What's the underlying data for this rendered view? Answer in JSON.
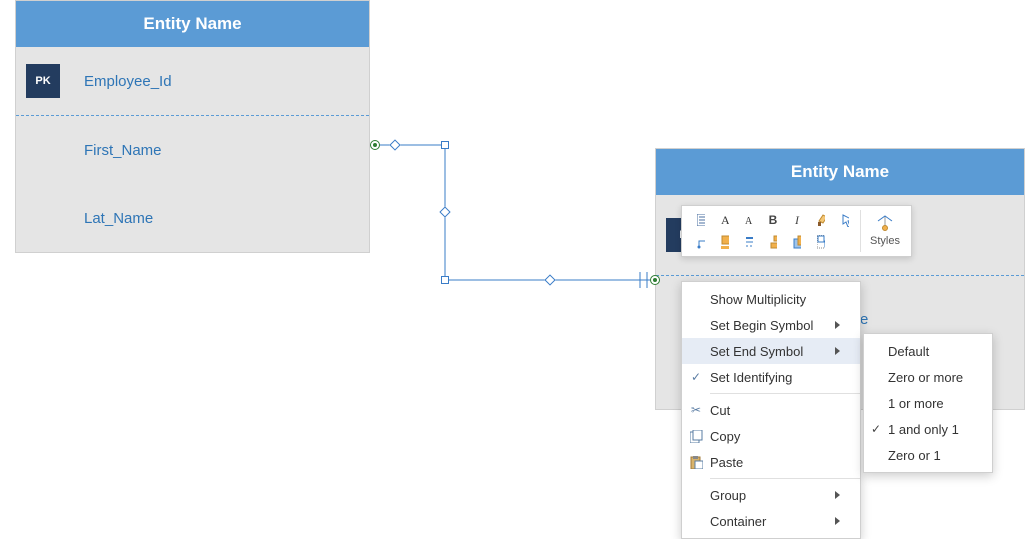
{
  "entity1": {
    "header": "Entity Name",
    "pk_badge": "PK",
    "attrs": [
      "Employee_Id",
      "First_Name",
      "Lat_Name"
    ]
  },
  "entity2": {
    "header": "Entity Name",
    "pk_badge_partial": "P",
    "peek_char": "e"
  },
  "mini_toolbar": {
    "styles_label": "Styles"
  },
  "context_menu": {
    "items": [
      {
        "label": "Show Multiplicity",
        "icon": "",
        "arrow": false
      },
      {
        "label": "Set Begin Symbol",
        "icon": "",
        "arrow": true
      },
      {
        "label": "Set End Symbol",
        "icon": "",
        "arrow": true,
        "highlight": true
      },
      {
        "label": "Set Identifying",
        "icon": "check",
        "arrow": false
      },
      {
        "sep": true
      },
      {
        "label": "Cut",
        "icon": "cut",
        "arrow": false
      },
      {
        "label": "Copy",
        "icon": "copy",
        "arrow": false
      },
      {
        "label": "Paste",
        "icon": "paste",
        "arrow": false
      },
      {
        "sep": true
      },
      {
        "label": "Group",
        "icon": "",
        "arrow": true
      },
      {
        "label": "Container",
        "icon": "",
        "arrow": true
      }
    ]
  },
  "submenu": {
    "items": [
      {
        "label": "Default",
        "checked": false
      },
      {
        "label": "Zero or more",
        "checked": false
      },
      {
        "label": "1 or more",
        "checked": false
      },
      {
        "label": "1 and only 1",
        "checked": true
      },
      {
        "label": "Zero or 1",
        "checked": false
      }
    ]
  },
  "chart_data": {
    "type": "diagram",
    "description": "ERD editor screenshot: two entity tables connected by a relationship line. A context menu is open on the relationship with 'Set End Symbol' highlighted, showing a submenu of cardinality options with '1 and only 1' checked. A floating mini formatting toolbar is shown above the second entity.",
    "entities": [
      {
        "title": "Entity Name",
        "primary_key": "Employee_Id",
        "attributes": [
          "First_Name",
          "Lat_Name"
        ]
      },
      {
        "title": "Entity Name",
        "primary_key": null,
        "attributes": []
      }
    ],
    "relationship": {
      "from_entity": 0,
      "to_entity": 1,
      "end_symbol": "1 and only 1",
      "identifying": true
    },
    "context_menu_open": true,
    "context_menu_highlight": "Set End Symbol",
    "submenu_checked": "1 and only 1"
  }
}
